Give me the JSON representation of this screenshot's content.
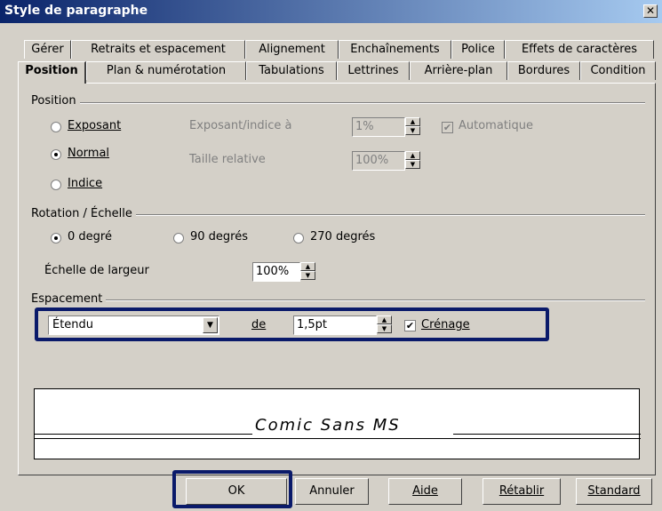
{
  "window": {
    "title": "Style de paragraphe",
    "close": "✕"
  },
  "tabs_row1": [
    "Gérer",
    "Retraits et espacement",
    "Alignement",
    "Enchaînements",
    "Police",
    "Effets de caractères"
  ],
  "tabs_row2": [
    "Position",
    "Plan & numérotation",
    "Tabulations",
    "Lettrines",
    "Arrière-plan",
    "Bordures",
    "Condition"
  ],
  "position": {
    "group": "Position",
    "exposant": "Exposant",
    "normal": "Normal",
    "indice": "Indice",
    "exposant_indice_label": "Exposant/indice à",
    "exposant_indice_value": "1%",
    "taille_label": "Taille relative",
    "taille_value": "100%",
    "automatique": "Automatique"
  },
  "rotation": {
    "group": "Rotation / Échelle",
    "r0": "0 degré",
    "r90": "90 degrés",
    "r270": "270 degrés",
    "echelle_label": "Échelle de largeur",
    "echelle_value": "100%"
  },
  "espacement": {
    "group": "Espacement",
    "mode": "Étendu",
    "de": "de",
    "value": "1,5pt",
    "crenage": "Crénage"
  },
  "preview": {
    "text": "Comic Sans MS"
  },
  "buttons": {
    "ok": "OK",
    "annuler": "Annuler",
    "aide": "Aide",
    "retablir": "Rétablir",
    "standard": "Standard"
  }
}
